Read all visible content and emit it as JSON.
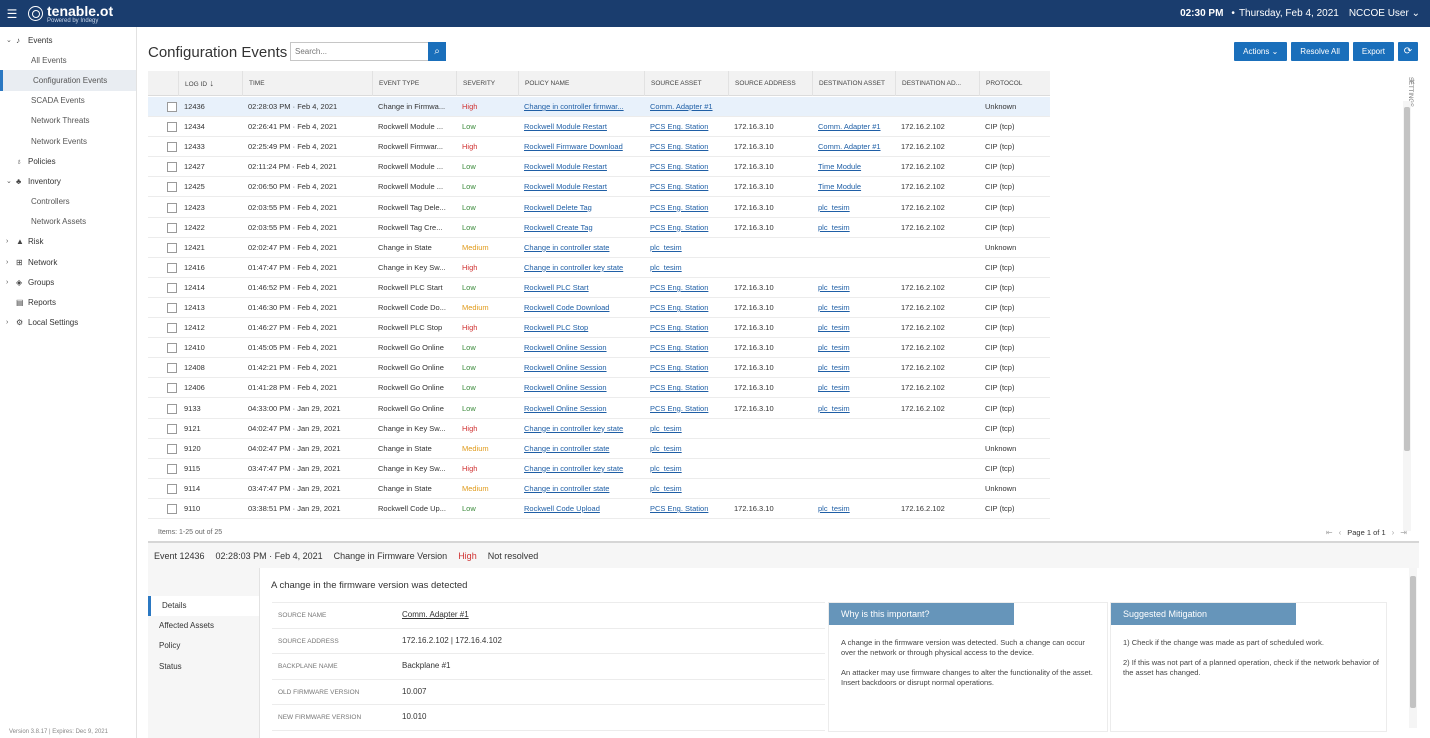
{
  "header": {
    "brand": "tenable.ot",
    "brand_sub": "Powered by Indegy",
    "time": "02:30 PM",
    "date": "Thursday, Feb 4, 2021",
    "user": "NCCOE User"
  },
  "sidebar": {
    "items": [
      {
        "label": "Events",
        "type": "top",
        "chev": "⌄",
        "icon": "bell-icon"
      },
      {
        "label": "All Events",
        "type": "sub"
      },
      {
        "label": "Configuration Events",
        "type": "sub",
        "active": true
      },
      {
        "label": "SCADA Events",
        "type": "sub"
      },
      {
        "label": "Network Threats",
        "type": "sub"
      },
      {
        "label": "Network Events",
        "type": "sub"
      },
      {
        "label": "Policies",
        "type": "top",
        "chev": "",
        "icon": "lightbulb-icon"
      },
      {
        "label": "Inventory",
        "type": "top",
        "chev": "⌄",
        "icon": "inventory-icon"
      },
      {
        "label": "Controllers",
        "type": "sub"
      },
      {
        "label": "Network Assets",
        "type": "sub"
      },
      {
        "label": "Risk",
        "type": "top",
        "chev": "›",
        "icon": "risk-icon"
      },
      {
        "label": "Network",
        "type": "top",
        "chev": "›",
        "icon": "network-icon"
      },
      {
        "label": "Groups",
        "type": "top",
        "chev": "›",
        "icon": "groups-icon"
      },
      {
        "label": "Reports",
        "type": "top",
        "chev": "",
        "icon": "reports-icon"
      },
      {
        "label": "Local Settings",
        "type": "top",
        "chev": "›",
        "icon": "settings-icon"
      }
    ],
    "version": "Version 3.8.17 | Expires: Dec 9, 2021"
  },
  "main": {
    "title": "Configuration Events",
    "search_placeholder": "Search...",
    "buttons": {
      "actions": "Actions",
      "resolve_all": "Resolve All",
      "export": "Export"
    },
    "settings_tab": "SETTINGS"
  },
  "table": {
    "columns": [
      "LOG ID",
      "TIME",
      "EVENT TYPE",
      "SEVERITY",
      "POLICY NAME",
      "SOURCE ASSET",
      "SOURCE ADDRESS",
      "DESTINATION ASSET",
      "DESTINATION AD...",
      "PROTOCOL"
    ],
    "rows": [
      {
        "id": "12436",
        "time": "02:28:03 PM · Feb 4, 2021",
        "type": "Change in Firmwa...",
        "severity": "High",
        "policy": "Change in controller firmwar...",
        "src_asset": "Comm. Adapter #1",
        "src_addr": "",
        "dst_asset": "",
        "dst_addr": "",
        "protocol": "Unknown",
        "selected": true
      },
      {
        "id": "12434",
        "time": "02:26:41 PM · Feb 4, 2021",
        "type": "Rockwell Module ...",
        "severity": "Low",
        "policy": "Rockwell Module Restart",
        "src_asset": "PCS Eng. Station",
        "src_addr": "172.16.3.10",
        "dst_asset": "Comm. Adapter #1",
        "dst_addr": "172.16.2.102",
        "protocol": "CIP (tcp)"
      },
      {
        "id": "12433",
        "time": "02:25:49 PM · Feb 4, 2021",
        "type": "Rockwell Firmwar...",
        "severity": "High",
        "policy": "Rockwell Firmware Download",
        "src_asset": "PCS Eng. Station",
        "src_addr": "172.16.3.10",
        "dst_asset": "Comm. Adapter #1",
        "dst_addr": "172.16.2.102",
        "protocol": "CIP (tcp)"
      },
      {
        "id": "12427",
        "time": "02:11:24 PM · Feb 4, 2021",
        "type": "Rockwell Module ...",
        "severity": "Low",
        "policy": "Rockwell Module Restart",
        "src_asset": "PCS Eng. Station",
        "src_addr": "172.16.3.10",
        "dst_asset": "Time Module",
        "dst_addr": "172.16.2.102",
        "protocol": "CIP (tcp)"
      },
      {
        "id": "12425",
        "time": "02:06:50 PM · Feb 4, 2021",
        "type": "Rockwell Module ...",
        "severity": "Low",
        "policy": "Rockwell Module Restart",
        "src_asset": "PCS Eng. Station",
        "src_addr": "172.16.3.10",
        "dst_asset": "Time Module",
        "dst_addr": "172.16.2.102",
        "protocol": "CIP (tcp)"
      },
      {
        "id": "12423",
        "time": "02:03:55 PM · Feb 4, 2021",
        "type": "Rockwell Tag Dele...",
        "severity": "Low",
        "policy": "Rockwell Delete Tag",
        "src_asset": "PCS Eng. Station",
        "src_addr": "172.16.3.10",
        "dst_asset": "plc_tesim",
        "dst_addr": "172.16.2.102",
        "protocol": "CIP (tcp)"
      },
      {
        "id": "12422",
        "time": "02:03:55 PM · Feb 4, 2021",
        "type": "Rockwell Tag Cre...",
        "severity": "Low",
        "policy": "Rockwell Create Tag",
        "src_asset": "PCS Eng. Station",
        "src_addr": "172.16.3.10",
        "dst_asset": "plc_tesim",
        "dst_addr": "172.16.2.102",
        "protocol": "CIP (tcp)"
      },
      {
        "id": "12421",
        "time": "02:02:47 PM · Feb 4, 2021",
        "type": "Change in State",
        "severity": "Medium",
        "policy": "Change in controller state",
        "src_asset": "plc_tesim",
        "src_addr": "",
        "dst_asset": "",
        "dst_addr": "",
        "protocol": "Unknown"
      },
      {
        "id": "12416",
        "time": "01:47:47 PM · Feb 4, 2021",
        "type": "Change in Key Sw...",
        "severity": "High",
        "policy": "Change in controller key state",
        "src_asset": "plc_tesim",
        "src_addr": "",
        "dst_asset": "",
        "dst_addr": "",
        "protocol": "CIP (tcp)"
      },
      {
        "id": "12414",
        "time": "01:46:52 PM · Feb 4, 2021",
        "type": "Rockwell PLC Start",
        "severity": "Low",
        "policy": "Rockwell PLC Start",
        "src_asset": "PCS Eng. Station",
        "src_addr": "172.16.3.10",
        "dst_asset": "plc_tesim",
        "dst_addr": "172.16.2.102",
        "protocol": "CIP (tcp)"
      },
      {
        "id": "12413",
        "time": "01:46:30 PM · Feb 4, 2021",
        "type": "Rockwell Code Do...",
        "severity": "Medium",
        "policy": "Rockwell Code Download",
        "src_asset": "PCS Eng. Station",
        "src_addr": "172.16.3.10",
        "dst_asset": "plc_tesim",
        "dst_addr": "172.16.2.102",
        "protocol": "CIP (tcp)"
      },
      {
        "id": "12412",
        "time": "01:46:27 PM · Feb 4, 2021",
        "type": "Rockwell PLC Stop",
        "severity": "High",
        "policy": "Rockwell PLC Stop",
        "src_asset": "PCS Eng. Station",
        "src_addr": "172.16.3.10",
        "dst_asset": "plc_tesim",
        "dst_addr": "172.16.2.102",
        "protocol": "CIP (tcp)"
      },
      {
        "id": "12410",
        "time": "01:45:05 PM · Feb 4, 2021",
        "type": "Rockwell Go Online",
        "severity": "Low",
        "policy": "Rockwell Online Session",
        "src_asset": "PCS Eng. Station",
        "src_addr": "172.16.3.10",
        "dst_asset": "plc_tesim",
        "dst_addr": "172.16.2.102",
        "protocol": "CIP (tcp)"
      },
      {
        "id": "12408",
        "time": "01:42:21 PM · Feb 4, 2021",
        "type": "Rockwell Go Online",
        "severity": "Low",
        "policy": "Rockwell Online Session",
        "src_asset": "PCS Eng. Station",
        "src_addr": "172.16.3.10",
        "dst_asset": "plc_tesim",
        "dst_addr": "172.16.2.102",
        "protocol": "CIP (tcp)"
      },
      {
        "id": "12406",
        "time": "01:41:28 PM · Feb 4, 2021",
        "type": "Rockwell Go Online",
        "severity": "Low",
        "policy": "Rockwell Online Session",
        "src_asset": "PCS Eng. Station",
        "src_addr": "172.16.3.10",
        "dst_asset": "plc_tesim",
        "dst_addr": "172.16.2.102",
        "protocol": "CIP (tcp)"
      },
      {
        "id": "9133",
        "time": "04:33:00 PM · Jan 29, 2021",
        "type": "Rockwell Go Online",
        "severity": "Low",
        "policy": "Rockwell Online Session",
        "src_asset": "PCS Eng. Station",
        "src_addr": "172.16.3.10",
        "dst_asset": "plc_tesim",
        "dst_addr": "172.16.2.102",
        "protocol": "CIP (tcp)"
      },
      {
        "id": "9121",
        "time": "04:02:47 PM · Jan 29, 2021",
        "type": "Change in Key Sw...",
        "severity": "High",
        "policy": "Change in controller key state",
        "src_asset": "plc_tesim",
        "src_addr": "",
        "dst_asset": "",
        "dst_addr": "",
        "protocol": "CIP (tcp)"
      },
      {
        "id": "9120",
        "time": "04:02:47 PM · Jan 29, 2021",
        "type": "Change in State",
        "severity": "Medium",
        "policy": "Change in controller state",
        "src_asset": "plc_tesim",
        "src_addr": "",
        "dst_asset": "",
        "dst_addr": "",
        "protocol": "Unknown"
      },
      {
        "id": "9115",
        "time": "03:47:47 PM · Jan 29, 2021",
        "type": "Change in Key Sw...",
        "severity": "High",
        "policy": "Change in controller key state",
        "src_asset": "plc_tesim",
        "src_addr": "",
        "dst_asset": "",
        "dst_addr": "",
        "protocol": "CIP (tcp)"
      },
      {
        "id": "9114",
        "time": "03:47:47 PM · Jan 29, 2021",
        "type": "Change in State",
        "severity": "Medium",
        "policy": "Change in controller state",
        "src_asset": "plc_tesim",
        "src_addr": "",
        "dst_asset": "",
        "dst_addr": "",
        "protocol": "Unknown"
      },
      {
        "id": "9110",
        "time": "03:38:51 PM · Jan 29, 2021",
        "type": "Rockwell Code Up...",
        "severity": "Low",
        "policy": "Rockwell Code Upload",
        "src_asset": "PCS Eng. Station",
        "src_addr": "172.16.3.10",
        "dst_asset": "plc_tesim",
        "dst_addr": "172.16.2.102",
        "protocol": "CIP (tcp)"
      }
    ],
    "items_count": "Items: 1-25 out of 25",
    "page_text": "Page 1 of 1"
  },
  "detail": {
    "event_label": "Event 12436",
    "time": "02:28:03 PM · Feb 4, 2021",
    "type": "Change in Firmware Version",
    "severity": "High",
    "status": "Not resolved",
    "tabs": [
      "Details",
      "Affected Assets",
      "Policy",
      "Status"
    ],
    "message": "A change in the firmware version was detected",
    "fields": [
      {
        "label": "SOURCE NAME",
        "value": "Comm. Adapter #1",
        "link": true
      },
      {
        "label": "SOURCE ADDRESS",
        "value": "172.16.2.102 | 172.16.4.102"
      },
      {
        "label": "BACKPLANE NAME",
        "value": "Backplane #1"
      },
      {
        "label": "OLD FIRMWARE VERSION",
        "value": "10.007"
      },
      {
        "label": "NEW FIRMWARE VERSION",
        "value": "10.010"
      }
    ],
    "why": {
      "title": "Why is this important?",
      "p1": "A change in the firmware version was detected. Such a change can occur over the network or through physical access to the device.",
      "p2": "An attacker may use firmware changes to alter the functionality of the asset. Insert backdoors or disrupt normal operations."
    },
    "mitigation": {
      "title": "Suggested Mitigation",
      "p1": "1) Check if the change was made as part of scheduled work.",
      "p2": "2) If this was not part of a planned operation, check if the network behavior of the asset has changed."
    }
  }
}
